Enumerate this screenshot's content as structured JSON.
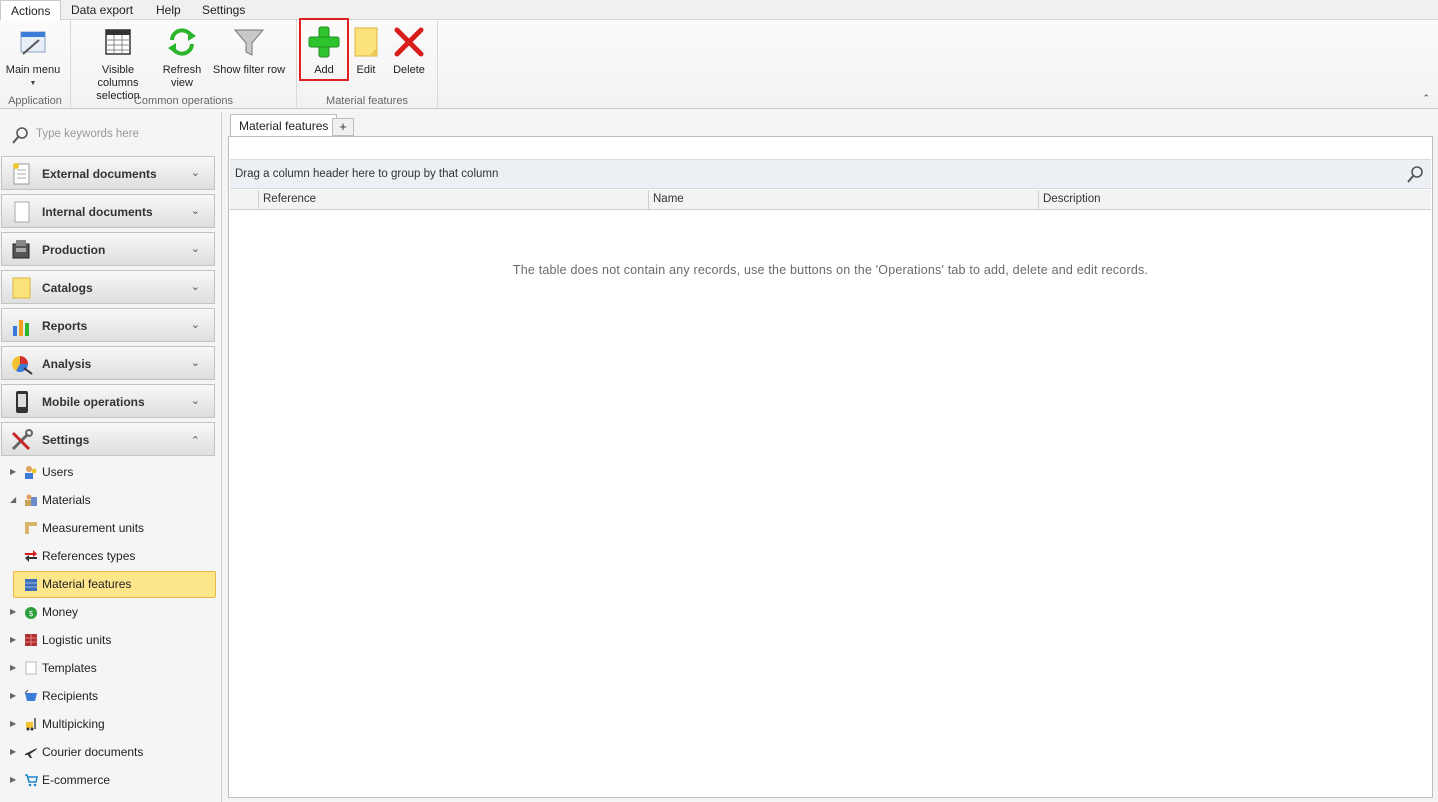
{
  "menu": {
    "tabs": [
      "Actions",
      "Data export",
      "Help",
      "Settings"
    ]
  },
  "ribbon": {
    "groups": {
      "application": "Application",
      "common": "Common operations",
      "material": "Material features"
    },
    "buttons": {
      "main_menu": "Main menu",
      "visible_columns_1": "Visible columns",
      "visible_columns_2": "selection",
      "refresh_1": "Refresh",
      "refresh_2": "view",
      "show_filter_row": "Show filter row",
      "add": "Add",
      "edit": "Edit",
      "delete": "Delete"
    },
    "icons": {
      "main_menu": "main-menu-icon",
      "visible_columns": "columns-icon",
      "refresh": "refresh-icon",
      "filter": "filter-icon",
      "add": "plus-icon",
      "edit": "edit-note-icon",
      "delete": "delete-x-icon"
    }
  },
  "sidebar": {
    "search_placeholder": "Type keywords here",
    "groups": [
      {
        "label": "External documents"
      },
      {
        "label": "Internal documents"
      },
      {
        "label": "Production"
      },
      {
        "label": "Catalogs"
      },
      {
        "label": "Reports"
      },
      {
        "label": "Analysis"
      },
      {
        "label": "Mobile operations"
      },
      {
        "label": "Settings"
      }
    ],
    "tree": [
      {
        "label": "Users"
      },
      {
        "label": "Materials"
      },
      {
        "label": "Measurement units"
      },
      {
        "label": "References types"
      },
      {
        "label": "Material features"
      },
      {
        "label": "Money"
      },
      {
        "label": "Logistic units"
      },
      {
        "label": "Templates"
      },
      {
        "label": "Recipients"
      },
      {
        "label": "Multipicking"
      },
      {
        "label": "Courier documents"
      },
      {
        "label": "E-commerce"
      }
    ]
  },
  "main": {
    "tab_label": "Material features",
    "add_tab": "+",
    "group_panel_text": "Drag a column header here to group by that column",
    "columns": [
      "Reference",
      "Name",
      "Description"
    ],
    "empty_message": "The table does not contain any records, use the buttons on the 'Operations' tab to add, delete and edit records."
  },
  "colors": {
    "selected_bg": "#fde58a",
    "add_green": "#2ec42e",
    "delete_red": "#d81b1b",
    "highlight_outline": "#e02020"
  }
}
